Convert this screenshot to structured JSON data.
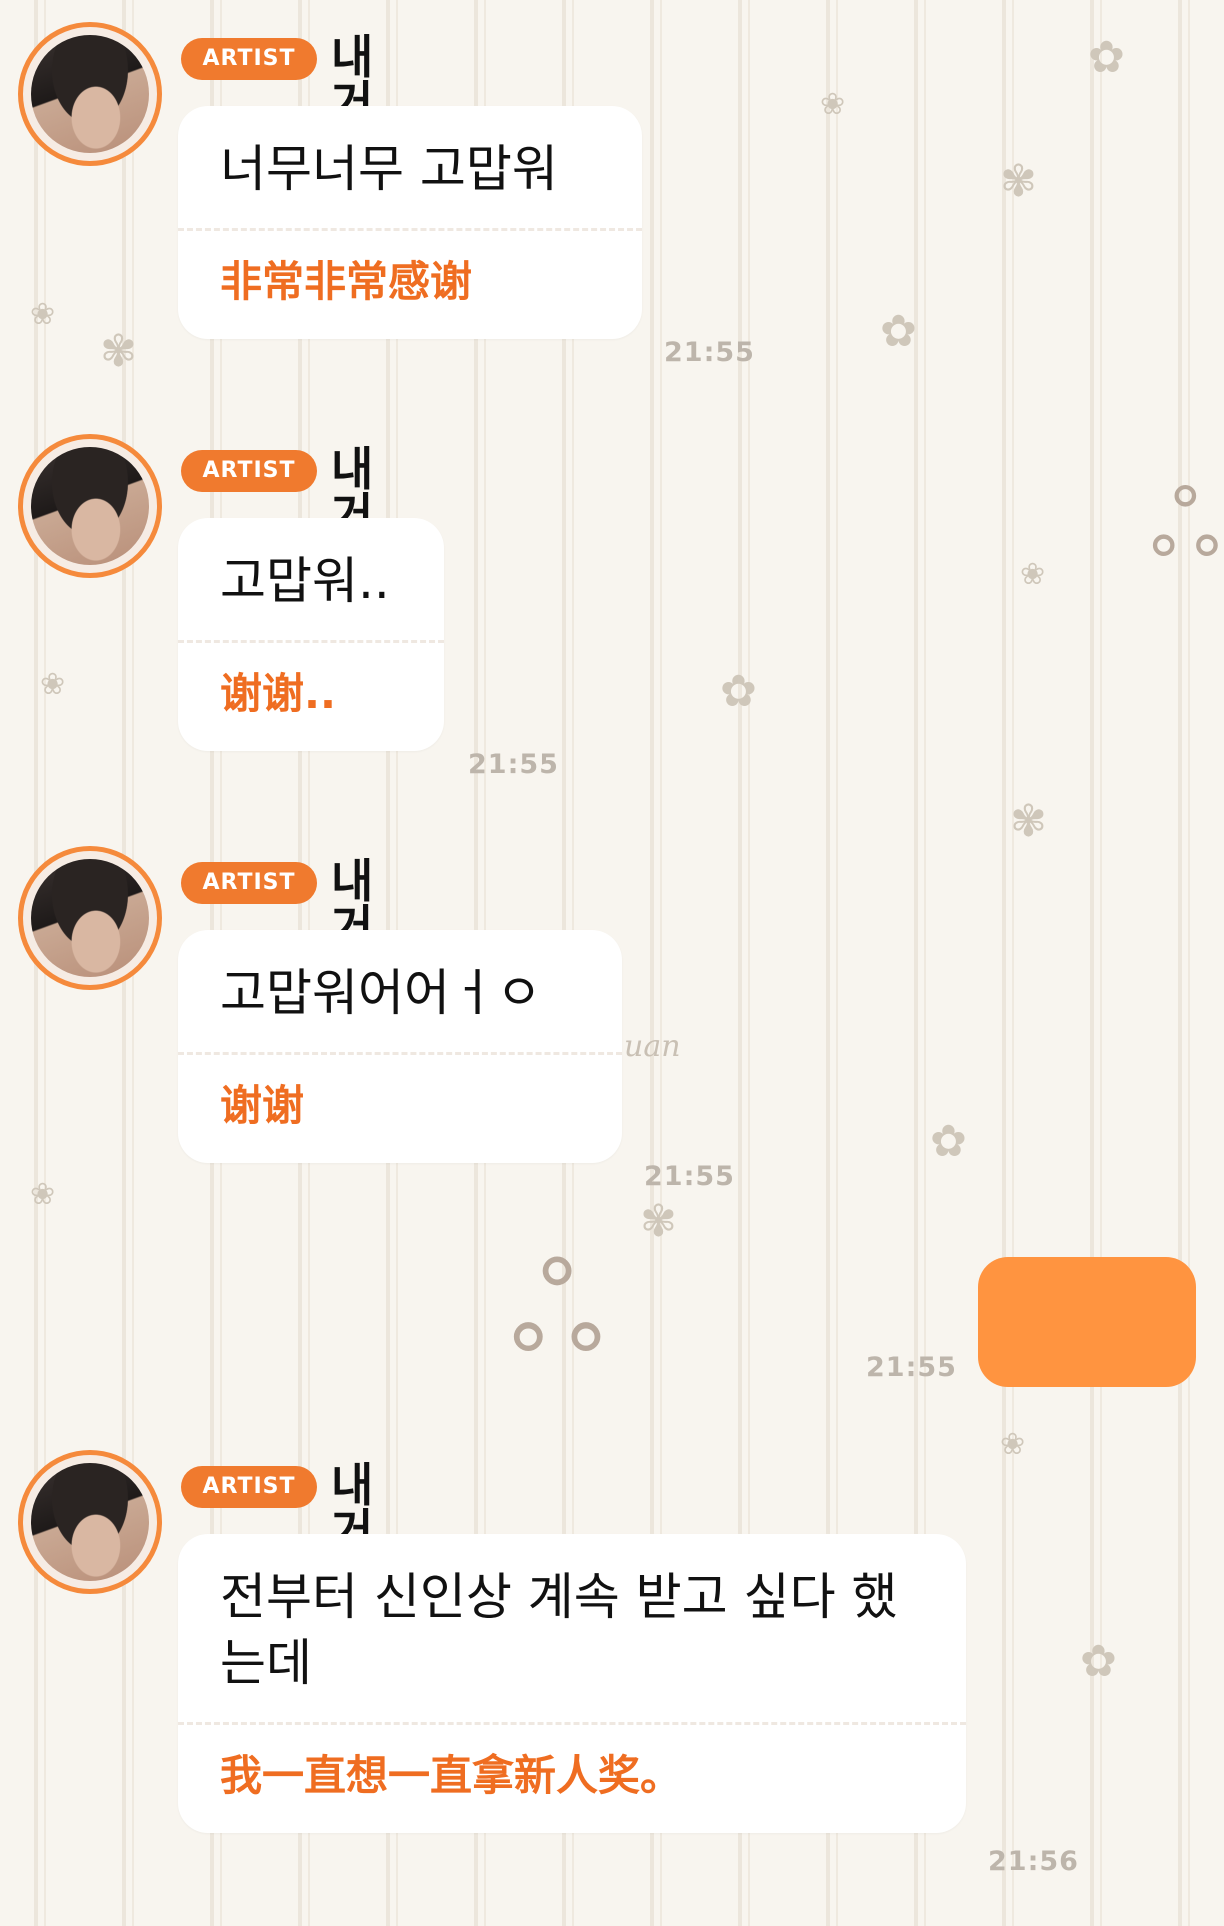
{
  "conversation": {
    "messages": [
      {
        "badge": "ARTIST",
        "sender": "내 거ㅓ",
        "korean": "너무너무 고맙워",
        "chinese": "非常非常感谢",
        "time": "21:55"
      },
      {
        "badge": "ARTIST",
        "sender": "내 거ㅓ",
        "korean": "고맙워..",
        "chinese": "谢谢..",
        "time": "21:55"
      },
      {
        "badge": "ARTIST",
        "sender": "내 거ㅓ",
        "korean": "고맙워어어ㅓㅇ",
        "chinese": "谢谢",
        "time": "21:55"
      },
      {
        "badge": "ARTIST",
        "sender": "내 거ㅓ",
        "korean": "전부터 신인상 계속 받고 싶다 했는데",
        "chinese": "我一直想一直拿新人奖。",
        "time": "21:56"
      }
    ],
    "outgoing": {
      "time": "21:55"
    }
  },
  "wallpaper": {
    "watermark": "uan"
  },
  "colors": {
    "accent": "#f07a2e",
    "outgoing_bubble": "#ff9440",
    "translation_text": "#ef6d21"
  },
  "icons": [
    "flower-icon",
    "bow-icon",
    "avatar"
  ]
}
